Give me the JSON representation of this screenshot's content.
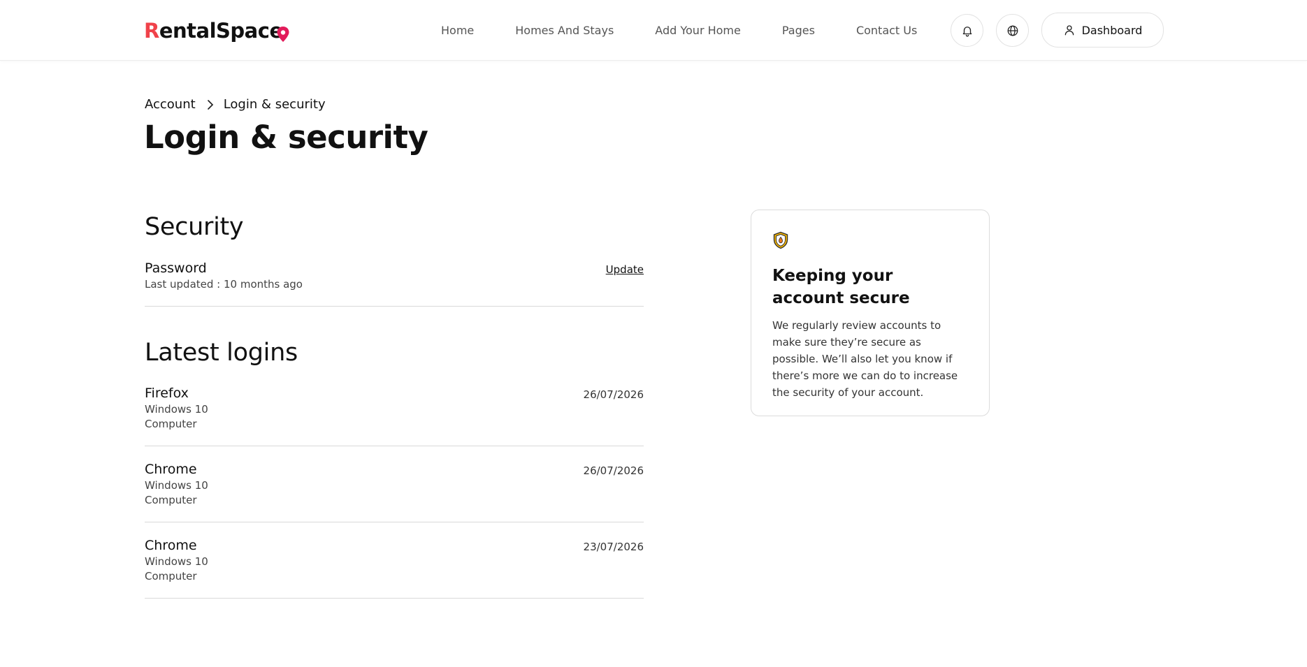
{
  "brand": {
    "name_first": "R",
    "name_rest": "entalSpac",
    "name_last": "e",
    "accent": "#f0424a",
    "pin_color": "#e21b5a"
  },
  "nav": {
    "items": [
      "Home",
      "Homes And Stays",
      "Add Your Home",
      "Pages",
      "Contact Us"
    ]
  },
  "header_actions": {
    "bell_icon": "bell-icon",
    "globe_icon": "globe-icon",
    "dashboard_label": "Dashboard",
    "dashboard_icon": "user-icon"
  },
  "breadcrumb": {
    "parent": "Account",
    "current": "Login & security"
  },
  "page": {
    "title": "Login & security"
  },
  "security": {
    "heading": "Security",
    "password": {
      "label": "Password",
      "status": "Last updated : 10 months ago",
      "action": "Update"
    }
  },
  "logins": {
    "heading": "Latest logins",
    "items": [
      {
        "browser": "Firefox",
        "os": "Windows 10",
        "device": "Computer",
        "date": "26/07/2026"
      },
      {
        "browser": "Chrome",
        "os": "Windows 10",
        "device": "Computer",
        "date": "26/07/2026"
      },
      {
        "browser": "Chrome",
        "os": "Windows 10",
        "device": "Computer",
        "date": "23/07/2026"
      }
    ]
  },
  "info_card": {
    "icon": "shield-icon",
    "title": "Keeping your account secure",
    "body": "We regularly review accounts to make sure they’re secure as possible. We’ll also let you know if there’s more we can do to increase the security of your account."
  }
}
